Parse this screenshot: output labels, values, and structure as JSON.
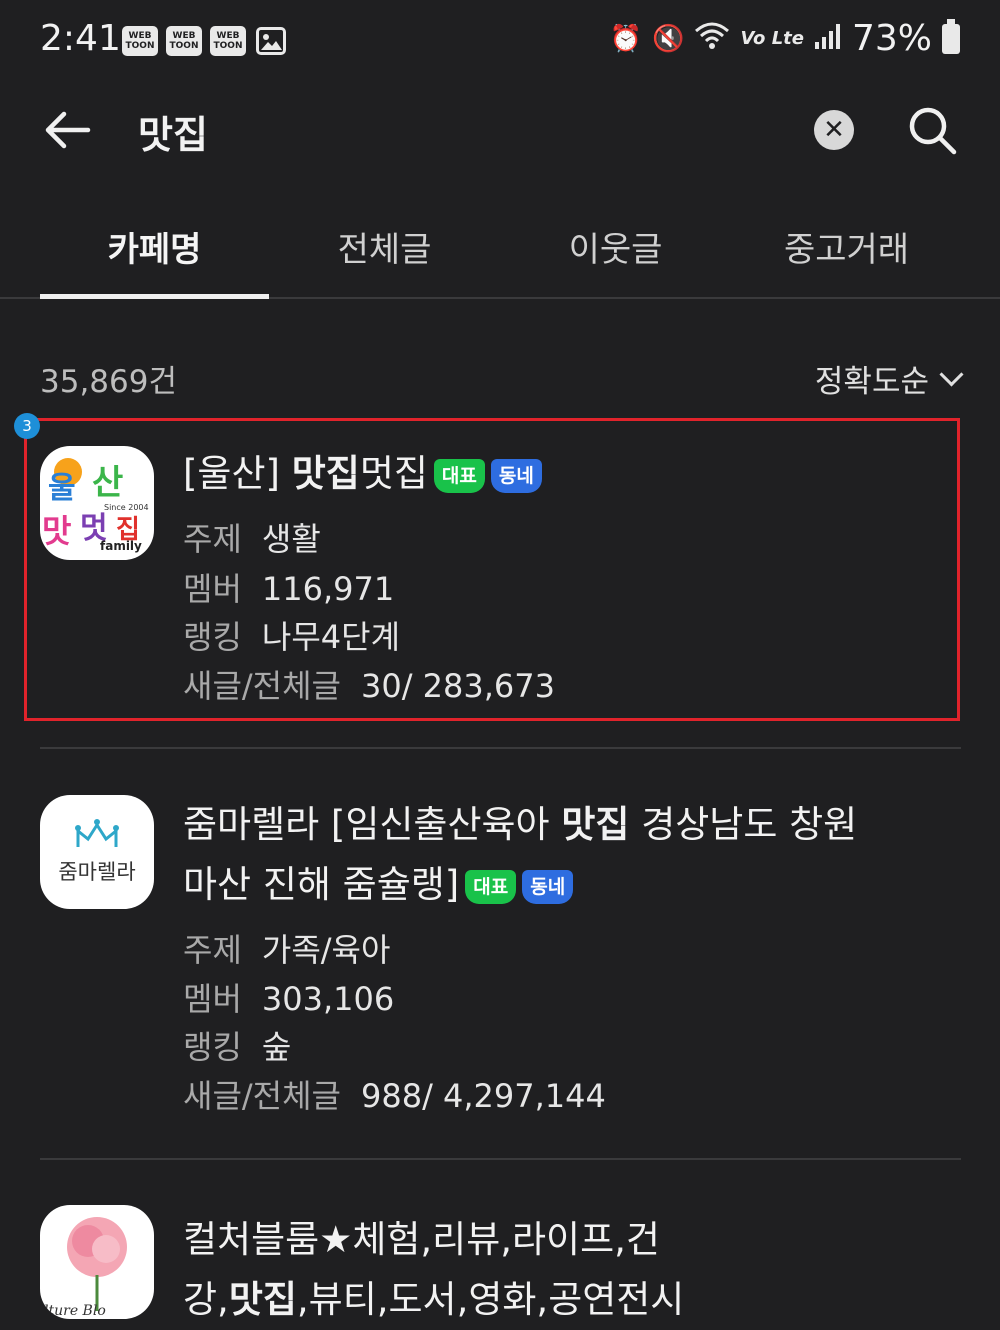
{
  "status_bar": {
    "time": "2:41",
    "notification_icons": [
      "WEB TOON",
      "WEB TOON",
      "WEB TOON",
      "image-icon"
    ],
    "battery": "73%",
    "network": "Vo Lte"
  },
  "header": {
    "title": "맛집",
    "back_icon": "arrow-left-icon",
    "clear_icon": "close-circle-icon",
    "search_icon": "search-icon"
  },
  "tabs": [
    {
      "label": "카페명",
      "active": true
    },
    {
      "label": "전체글",
      "active": false
    },
    {
      "label": "이웃글",
      "active": false
    },
    {
      "label": "중고거래",
      "active": false
    }
  ],
  "results": {
    "count": "35,869건",
    "sort_label": "정확도순"
  },
  "labels": {
    "topic": "주제",
    "members": "멤버",
    "ranking": "랭킹",
    "posts": "새글/전체글",
    "tag_rep": "대표",
    "tag_local": "동네"
  },
  "highlight_badge": "3",
  "cafes": [
    {
      "name_prefix": "[울산] ",
      "name_bold": "맛집",
      "name_suffix": "멋집",
      "topic": "생활",
      "members": "116,971",
      "ranking": "나무4단계",
      "posts": "30/ 283,673",
      "thumb_text": [
        "울산",
        "맛집",
        "멋",
        "Since 2004",
        "family"
      ]
    },
    {
      "name_prefix": "줌마렐라 [임신출산육아 ",
      "name_bold": "맛집",
      "name_suffix": " 경상남도 창원",
      "name_line2": "마산 진해 줌슐랭]",
      "topic": "가족/육아",
      "members": "303,106",
      "ranking": "숲",
      "posts": "988/ 4,297,144",
      "thumb_text": [
        "줌마렐라"
      ]
    },
    {
      "name_line1": "컬처블룸★체험,리뷰,라이프,건",
      "name_line2_prefix": "강,",
      "name_bold": "맛집",
      "name_line2_suffix": ",뷰티,도서,영화,공연전시",
      "thumb_text": [
        "lture Blo"
      ]
    }
  ]
}
